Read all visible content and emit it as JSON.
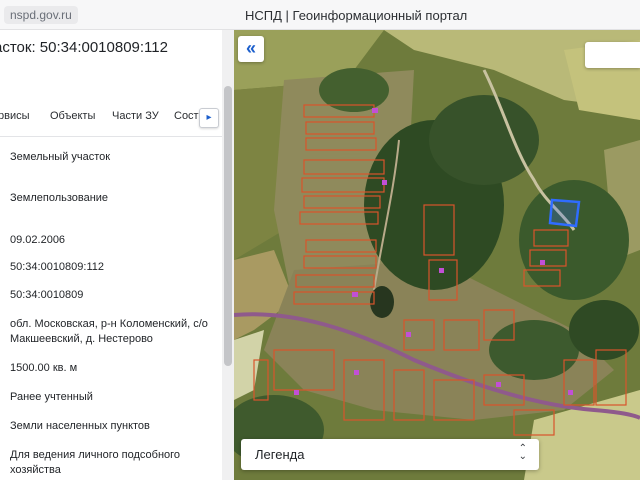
{
  "browser": {
    "url": "nspd.gov.ru",
    "title": "НСПД | Геоинформационный портал"
  },
  "panel": {
    "title": "асток: 50:34:0010809:112",
    "tabs": [
      "рвисы",
      "Объекты",
      "Части ЗУ",
      "Соста"
    ],
    "tab_scroll_icon": "chevron-right-icon",
    "fields": [
      "Земельный участок",
      "Землепользование",
      "09.02.2006",
      "50:34:0010809:112",
      "50:34:0010809",
      "обл. Московская, р-н Коломенский, с/о Макшеевский, д. Нестерово",
      "1500.00 кв. м",
      "Ранее учтенный",
      "Земли населенных пунктов",
      "Для ведения личного подсобного хозяйства"
    ]
  },
  "map": {
    "collapse_icon": "double-chevron-left-icon",
    "highlight_color": "#2f6cff",
    "parcel_color": "#d9542b",
    "legend": {
      "label": "Легенда",
      "icon": "chevron-up-down-icon"
    }
  }
}
